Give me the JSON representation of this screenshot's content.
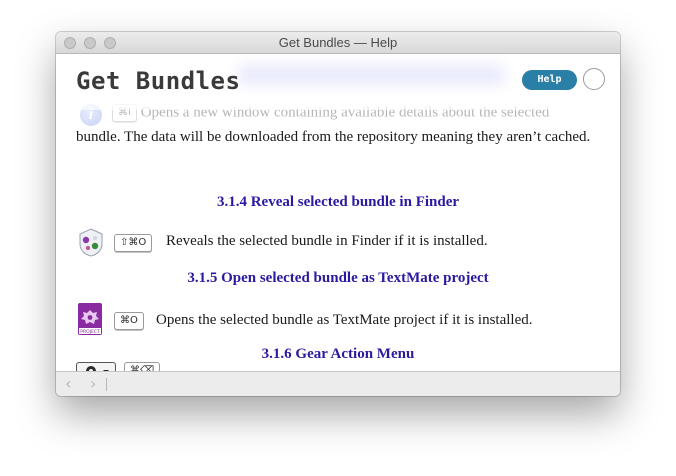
{
  "window": {
    "title": "Get Bundles — Help"
  },
  "header": {
    "title": "Get Bundles",
    "help_label": "Help"
  },
  "faded_entry": {
    "shortcut": "⌘I",
    "text": "Opens a new window containing available details about the selected"
  },
  "continued_paragraph": "bundle. The data will be downloaded from the repository meaning they aren’t cached.",
  "sections": [
    {
      "heading": "3.1.4 Reveal selected bundle in Finder",
      "shortcut": "⇧⌘O",
      "text": "Reveals the selected bundle in Finder if it is installed."
    },
    {
      "heading": "3.1.5 Open selected bundle as TextMate project",
      "shortcut": "⌘O",
      "text": "Opens the selected bundle as TextMate project if it is installed."
    },
    {
      "heading": "3.1.6 Gear Action Menu",
      "shortcut": "⌘⌫"
    }
  ],
  "project_icon_label": "PROJECT",
  "footer": {
    "back_label": "‹",
    "forward_label": "›"
  },
  "colors": {
    "heading": "#2a1aa0",
    "help_button": "#2a7fa6"
  }
}
